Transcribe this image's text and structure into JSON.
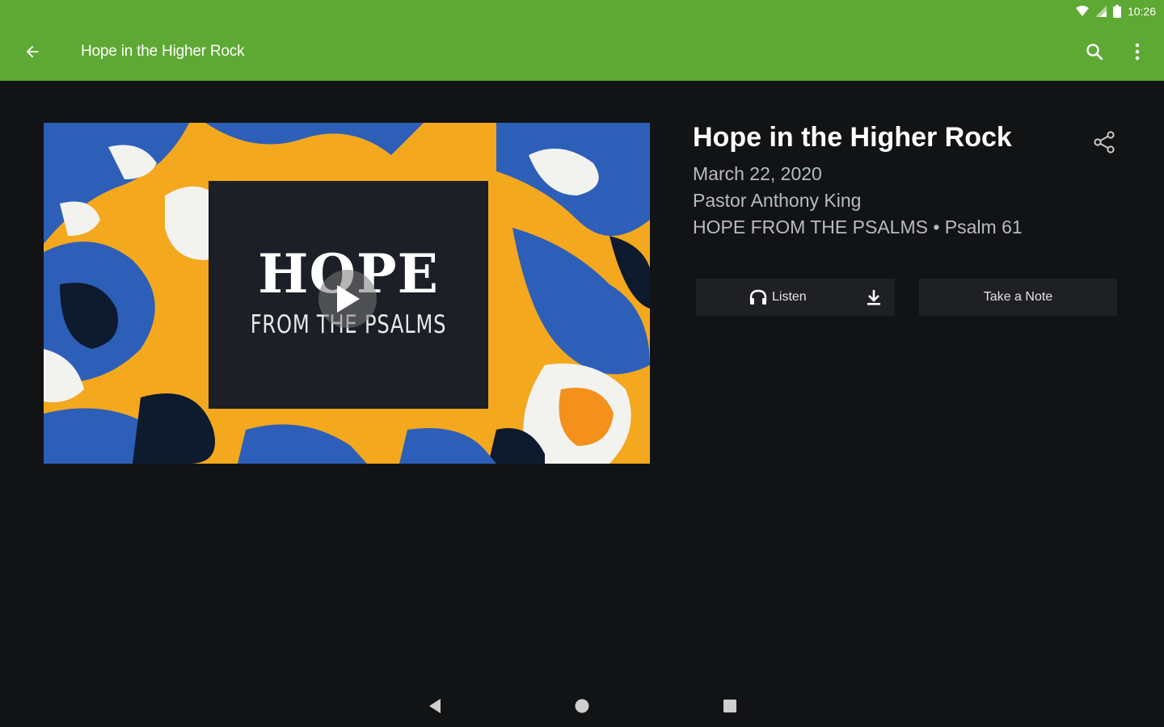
{
  "status_bar": {
    "time": "10:26",
    "icons": [
      "wifi-icon",
      "signal-icon",
      "battery-icon"
    ]
  },
  "app_bar": {
    "title": "Hope in the Higher Rock",
    "background_color": "#5ea834",
    "icons": [
      "back-arrow-icon",
      "search-icon",
      "more-vert-icon"
    ]
  },
  "artwork": {
    "line1": "HOPE",
    "line2": "FROM THE PSALMS",
    "icon": "play-icon"
  },
  "details": {
    "title": "Hope in the Higher Rock",
    "date": "March 22, 2020",
    "speaker": "Pastor Anthony King",
    "series": "HOPE FROM THE PSALMS • Psalm 61",
    "icon": "share-icon"
  },
  "actions": {
    "listen_label": "Listen",
    "note_label": "Take a Note",
    "icons": [
      "headphones-icon",
      "download-icon"
    ]
  },
  "nav_bar": {
    "icons": [
      "nav-back-icon",
      "nav-home-icon",
      "nav-recent-icon"
    ]
  }
}
